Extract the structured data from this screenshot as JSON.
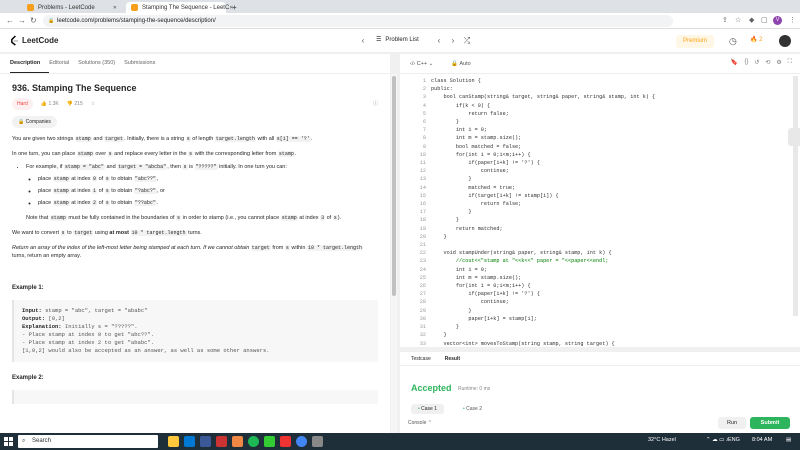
{
  "browser": {
    "tabs": [
      {
        "title": "Problems - LeetCode",
        "close": "✕"
      },
      {
        "title": "Stamping The Sequence - LeetC",
        "close": "✕"
      }
    ],
    "new_tab": "+",
    "url": "leetcode.com/problems/stamping-the-sequence/description/",
    "avatar_letter": "V"
  },
  "header": {
    "logo": "LeetCode",
    "problem_list": "Problem List",
    "premium": "Premium",
    "streak": "2"
  },
  "left": {
    "tabs": [
      "Description",
      "Editorial",
      "Solutions (350)",
      "Submissions"
    ],
    "title": "936. Stamping The Sequence",
    "difficulty": "Hard",
    "likes": "1.3K",
    "dislikes": "215",
    "companies": "Companies",
    "p1_a": "You are given two strings",
    "p1_c1": "stamp",
    "p1_b": "and",
    "p1_c2": "target",
    "p1_c": ". Initially, there is a string",
    "p1_c3": "s",
    "p1_d": "of length",
    "p1_c4": "target.length",
    "p1_e": "with all",
    "p1_c5": "s[i] == '?'",
    "p1_f": ".",
    "p2_a": "In one turn, you can place",
    "p2_c1": "stamp",
    "p2_b": "over",
    "p2_c2": "s",
    "p2_c": "and replace every letter in the",
    "p2_c3": "s",
    "p2_d": "with the corresponding letter from",
    "p2_c4": "stamp",
    "p2_e": ".",
    "b1_a": "For example, if",
    "b1_c1": "stamp = \"abc\"",
    "b1_b": "and",
    "b1_c2": "target = \"abcba\"",
    "b1_c": ", then",
    "b1_c3": "s",
    "b1_d": "is",
    "b1_c4": "\"?????\"",
    "b1_e": "initially. In one turn you can:",
    "s1_a": "place",
    "s1_c1": "stamp",
    "s1_b": "at index",
    "s1_c2": "0",
    "s1_c": "of",
    "s1_c3": "s",
    "s1_d": "to obtain",
    "s1_c4": "\"abc??\"",
    "s1_e": ",",
    "s2_a": "place",
    "s2_c1": "stamp",
    "s2_b": "at index",
    "s2_c2": "1",
    "s2_c": "of",
    "s2_c3": "s",
    "s2_d": "to obtain",
    "s2_c4": "\"?abc?\"",
    "s2_e": ", or",
    "s3_a": "place",
    "s3_c1": "stamp",
    "s3_b": "at index",
    "s3_c2": "2",
    "s3_c": "of",
    "s3_c3": "s",
    "s3_d": "to obtain",
    "s3_c4": "\"??abc\"",
    "s3_e": ".",
    "n_a": "Note that",
    "n_c1": "stamp",
    "n_b": "must be fully contained in the boundaries of",
    "n_c2": "s",
    "n_c": "in order to stamp (i.e., you cannot place",
    "n_c3": "stamp",
    "n_d": "at index",
    "n_c4": "3",
    "n_e": "of",
    "n_c5": "s",
    "n_f": ").",
    "p3_a": "We want to convert",
    "p3_c1": "s",
    "p3_b": "to",
    "p3_c2": "target",
    "p3_c": "using",
    "p3_strong": "at most",
    "p3_c3": "10 * target.length",
    "p3_d": "turns.",
    "p4_a": "Return an array of the index of the left-most letter being stamped at each turn. If we cannot obtain",
    "p4_c1": "target",
    "p4_b": "from",
    "p4_c2": "s",
    "p4_c": "within",
    "p4_c3": "10 * target.length",
    "p4_d": "turns, return an empty array.",
    "example1": "Example 1:",
    "ex1_input_label": "Input:",
    "ex1_input": " stamp = \"abc\", target = \"ababc\"",
    "ex1_output_label": "Output:",
    "ex1_output": " [0,2]",
    "ex1_expl_label": "Explanation:",
    "ex1_expl": " Initially s = \"?????\".",
    "ex1_l1": "- Place stamp at index 0 to get \"abc??\".",
    "ex1_l2": "- Place stamp at index 2 to get \"ababc\".",
    "ex1_l3": "[1,0,2] would also be accepted as an answer, as well as some other answers.",
    "example2": "Example 2:"
  },
  "editor": {
    "language": "C++",
    "mode": "Auto",
    "lines": [
      "class Solution {",
      "public:",
      "    bool canStamp(string& target, string& paper, string& stamp, int k) {",
      "        if(k < 0) {",
      "            return false;",
      "        }",
      "        int i = 0;",
      "        int m = stamp.size();",
      "        bool matched = false;",
      "        for(int i = 0;i<m;i++) {",
      "            if(paper[i+k] != '?') {",
      "                continue;",
      "            }",
      "            matched = true;",
      "            if(target[i+k] != stamp[i]) {",
      "                return false;",
      "            }",
      "        }",
      "        return matched;",
      "    }",
      "",
      "    void stampUnder(string& paper, string& stamp, int k) {",
      "        //cout<<\"stamp at \"<<k<<\" paper = \"<<paper<<endl;",
      "        int i = 0;",
      "        int m = stamp.size();",
      "        for(int i = 0;i<m;i++) {",
      "            if(paper[i+k] != '?') {",
      "                continue;",
      "            }",
      "            paper[i+k] = stamp[i];",
      "        }",
      "    }",
      "    vector<int> movesToStamp(string stamp, string target) {"
    ]
  },
  "bottom": {
    "tabs": [
      "Testcase",
      "Result"
    ],
    "status": "Accepted",
    "runtime": "Runtime: 0 ms",
    "case1": "Case 1",
    "case2": "Case 2",
    "console": "Console",
    "run": "Run",
    "submit": "Submit"
  },
  "taskbar": {
    "search": "Search",
    "weather": "32°C  Hazel",
    "lang": "ENG",
    "time": "8:04 AM"
  }
}
